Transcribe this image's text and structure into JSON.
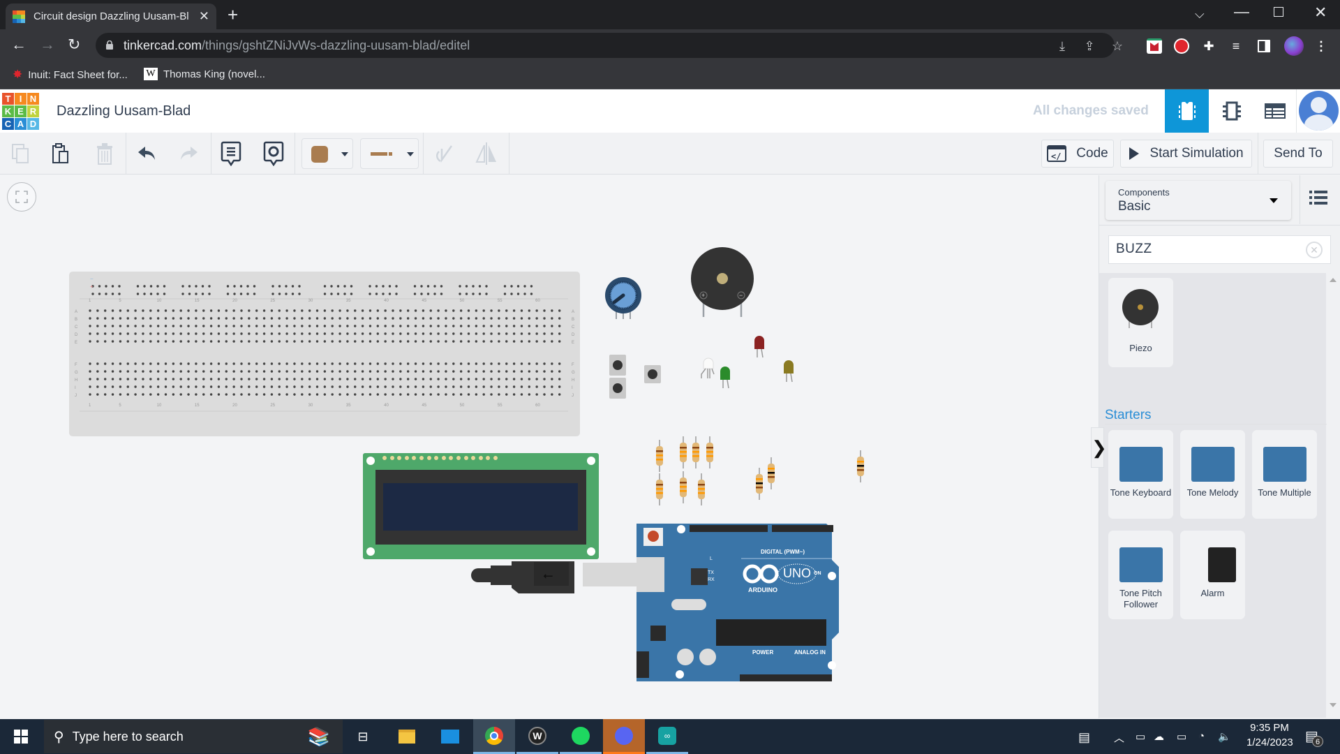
{
  "browser": {
    "tab_title": "Circuit design Dazzling Uusam-Bl",
    "new_tab": "+",
    "url_host": "tinkercad.com",
    "url_path": "/things/gshtZNiJvWs-dazzling-uusam-blad/editel",
    "bookmarks": [
      {
        "label": "Inuit: Fact Sheet for...",
        "icon": "maple-leaf-icon"
      },
      {
        "label": "Thomas King (novel...",
        "icon": "wikipedia-icon"
      }
    ]
  },
  "app": {
    "logo_letters": [
      "T",
      "I",
      "N",
      "K",
      "E",
      "R",
      "C",
      "A",
      "D"
    ],
    "logo_colors": [
      "#e8532b",
      "#f6891f",
      "#f6891f",
      "#5bbb47",
      "#5bbb47",
      "#c0d33d",
      "#1763b4",
      "#2a8ed6",
      "#56b8e6"
    ],
    "design_title": "Dazzling Uusam-Blad",
    "save_status": "All changes saved",
    "accent_color": "#0e96d8"
  },
  "toolbar": {
    "code_label": "Code",
    "start_simulation_label": "Start Simulation",
    "send_to_label": "Send To",
    "wire_color": "#a97c4f"
  },
  "sidebar": {
    "components_label": "Components",
    "components_value": "Basic",
    "search_value": "BUZZ",
    "results": [
      {
        "label": "Piezo"
      }
    ],
    "starters_title": "Starters",
    "starters": [
      {
        "label": "Tone Keyboard"
      },
      {
        "label": "Tone Melody"
      },
      {
        "label": "Tone Multiple"
      },
      {
        "label": "Tone Pitch Follower"
      },
      {
        "label": "Alarm"
      }
    ]
  },
  "canvas": {
    "breadboard_columns": [
      "1",
      "5",
      "10",
      "15",
      "20",
      "25",
      "30",
      "35",
      "40",
      "45",
      "50",
      "55",
      "60"
    ],
    "breadboard_rows_top": [
      "A",
      "B",
      "C",
      "D",
      "E"
    ],
    "breadboard_rows_bottom": [
      "F",
      "G",
      "H",
      "I",
      "J"
    ],
    "arduino_brand": "ARDUINO",
    "arduino_model": "UNO",
    "arduino_digital_label": "DIGITAL (PWM~)",
    "arduino_power_label": "POWER",
    "arduino_analog_label": "ANALOG IN",
    "arduino_on_label": "ON",
    "arduino_l_label": "L",
    "arduino_tx_label": "TX",
    "arduino_rx_label": "RX"
  },
  "taskbar": {
    "search_placeholder": "Type here to search",
    "time": "9:35 PM",
    "date": "1/24/2023",
    "notification_count": "6"
  }
}
